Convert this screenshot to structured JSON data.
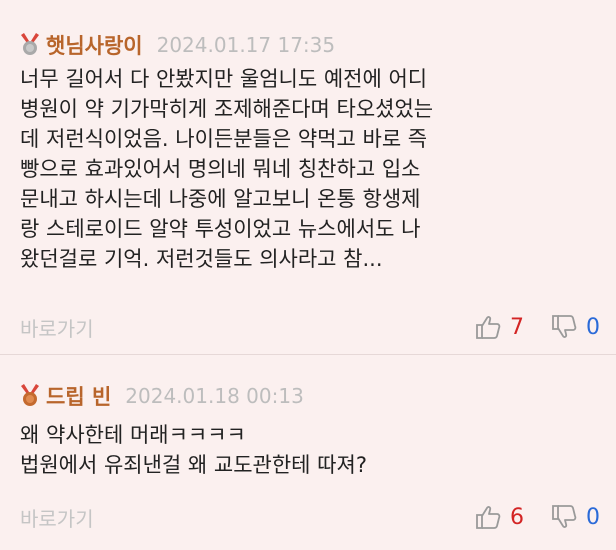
{
  "comments": [
    {
      "nickname": "햇님사랑이",
      "medal": "silver",
      "date": "2024.01.17 17:35",
      "lines": [
        "너무 길어서 다 안봤지만 울엄니도 예전에 어디",
        "병원이 약 기가막히게 조제해준다며 타오셨었는",
        "데 저런식이었음. 나이든분들은 약먹고 바로 즉",
        "빵으로 효과있어서 명의네 뭐네 칭찬하고 입소",
        "문내고 하시는데 나중에 알고보니 온통 항생제",
        "랑 스테로이드 알약 투성이었고 뉴스에서도 나",
        "왔던걸로 기억. 저런것들도 의사라고 참..."
      ],
      "goto_label": "바로가기",
      "upvotes": "7",
      "downvotes": "0"
    },
    {
      "nickname": "드립 빈",
      "medal": "bronze",
      "date": "2024.01.18 00:13",
      "lines": [
        "왜 약사한테 머래ㅋㅋㅋㅋ",
        "법원에서 유죄낸걸 왜 교도관한테 따져?"
      ],
      "goto_label": "바로가기",
      "upvotes": "6",
      "downvotes": "0"
    }
  ],
  "colors": {
    "background": "#fbf0ef",
    "nickname": "#b8652b",
    "upvote": "#d32424",
    "downvote": "#2a6ad8",
    "silver_medal": "#a9a9a9",
    "bronze_medal": "#c46a2f",
    "ribbon": "#d9453a"
  },
  "icons": [
    "medal-icon",
    "thumbs-up-icon",
    "thumbs-down-icon"
  ]
}
